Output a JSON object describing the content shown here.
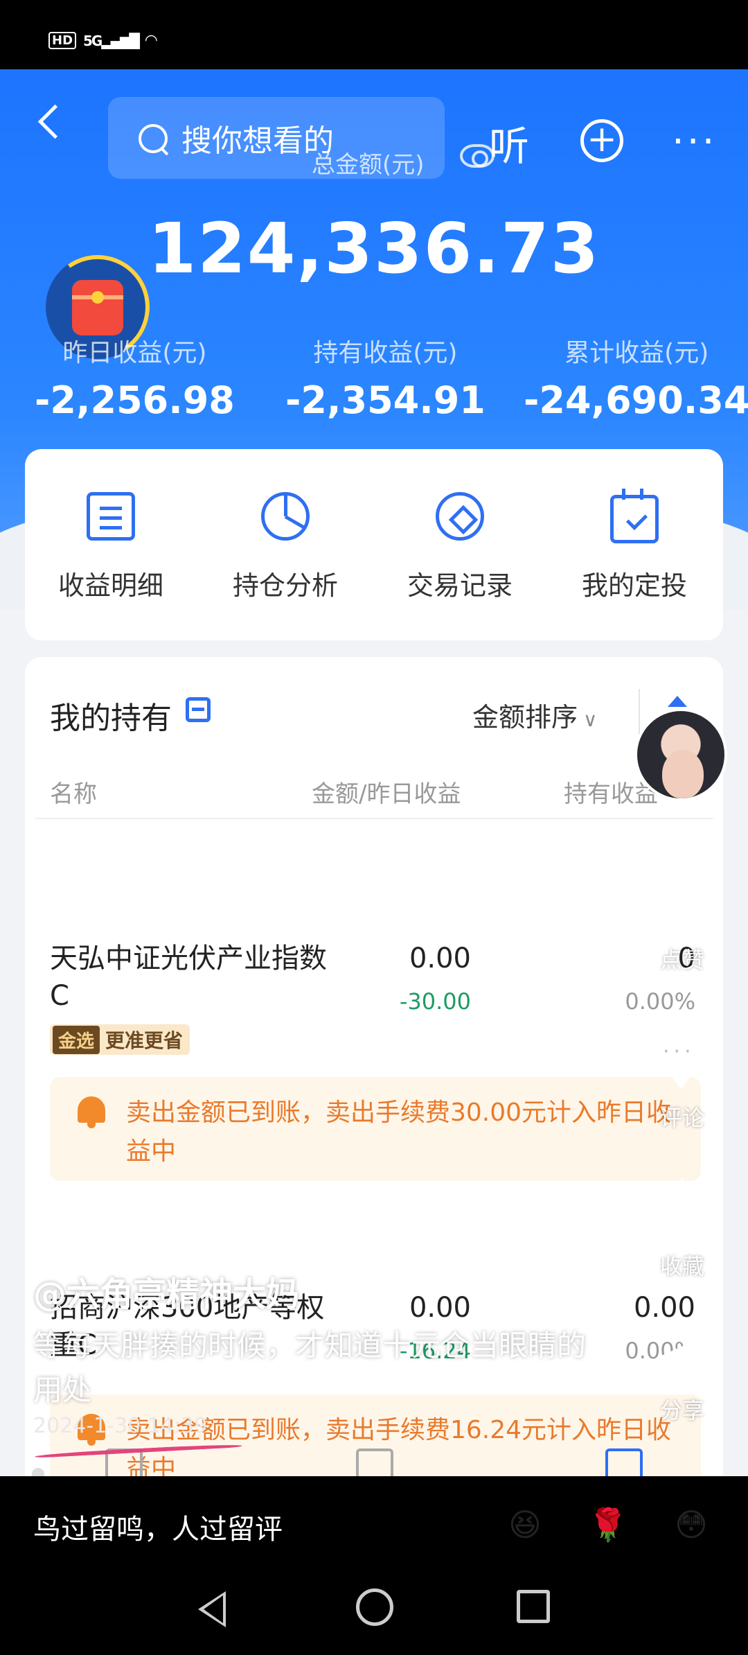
{
  "search": {
    "placeholder": "搜你想看的"
  },
  "header": {
    "listen_label": "听",
    "add_icon": "plus-circle-icon",
    "more_icon": "more-dots-icon"
  },
  "summary": {
    "total_label": "总金额(元)",
    "total_amount": "124,336.73",
    "stats": [
      {
        "label": "昨日收益(元)",
        "value": "-2,256.98"
      },
      {
        "label": "持有收益(元)",
        "value": "-2,354.91"
      },
      {
        "label": "累计收益(元)",
        "value": "-24,690.34"
      }
    ]
  },
  "quick_actions": [
    {
      "label": "收益明细",
      "icon": "document-icon"
    },
    {
      "label": "持仓分析",
      "icon": "pie-chart-icon"
    },
    {
      "label": "交易记录",
      "icon": "record-icon"
    },
    {
      "label": "我的定投",
      "icon": "calendar-icon"
    }
  ],
  "holdings": {
    "title": "我的持有",
    "sort_label": "金额排序",
    "columns": [
      "名称",
      "金额/昨日收益",
      "持有收益"
    ],
    "funds": [
      {
        "name": "天弘中证光伏产业指数C",
        "amount": "0.00",
        "yesterday": "-30.00",
        "hold": "0",
        "hold_pct": "0.00%",
        "badge_tag": "金选",
        "badge_text": "更准更省",
        "notice": "卖出金额已到账，卖出手续费30.00元计入昨日收益中"
      },
      {
        "name": "招商沪深300地产等权重C",
        "amount": "0.00",
        "yesterday": "-16.24",
        "hold": "0.00",
        "hold_pct": "0.00%",
        "notice": "卖出金额已到账，卖出手续费16.24元计入昨日收益中"
      }
    ]
  },
  "social": {
    "like_label": "点赞",
    "comment_label": "评论",
    "favorite_label": "收藏",
    "share_label": "分享"
  },
  "post": {
    "author": "@六角亭精神大妈",
    "caption": "等每天胖揍的时候，才知道十元仓当眼睛的用处",
    "date": "2024-1-30 14:39"
  },
  "comment_bar": {
    "placeholder": "鸟过留鸣，人过留评",
    "emojis": [
      "😆",
      "🌹",
      "😳"
    ]
  },
  "colors": {
    "brand_blue": "#1d74ff",
    "loss_green": "#1d9b63",
    "notice_orange": "#e97a2b",
    "progress_pink": "#e2457c"
  }
}
